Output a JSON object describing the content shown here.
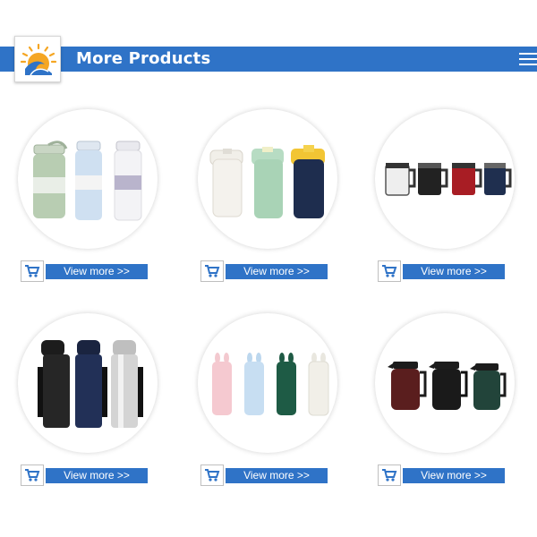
{
  "header": {
    "title": "More Products",
    "logo_icon": "sun-wave-logo-icon",
    "menu_icon": "hamburger-menu-icon"
  },
  "colors": {
    "brand_blue": "#2f73c7",
    "logo_orange": "#f5a623",
    "logo_blue": "#2f73c7"
  },
  "products": [
    {
      "image": "sports-water-bottles",
      "view_more_label": "View more >>",
      "cart_icon": "shopping-cart-icon"
    },
    {
      "image": "straw-tumblers",
      "view_more_label": "View more >>",
      "cart_icon": "shopping-cart-icon"
    },
    {
      "image": "camping-mugs",
      "view_more_label": "View more >>",
      "cart_icon": "shopping-cart-icon"
    },
    {
      "image": "travel-flasks",
      "view_more_label": "View more >>",
      "cart_icon": "shopping-cart-icon"
    },
    {
      "image": "rabbit-ear-bottles",
      "view_more_label": "View more >>",
      "cart_icon": "shopping-cart-icon"
    },
    {
      "image": "coffee-pots",
      "view_more_label": "View more >>",
      "cart_icon": "shopping-cart-icon"
    }
  ]
}
